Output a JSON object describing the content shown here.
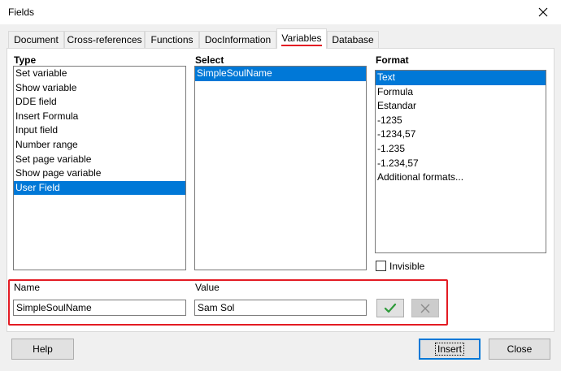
{
  "window": {
    "title": "Fields"
  },
  "tabs": [
    {
      "label": "Document"
    },
    {
      "label": "Cross-references"
    },
    {
      "label": "Functions"
    },
    {
      "label": "DocInformation"
    },
    {
      "label": "Variables"
    },
    {
      "label": "Database"
    }
  ],
  "type": {
    "label": "Type",
    "items": [
      "Set variable",
      "Show variable",
      "DDE field",
      "Insert Formula",
      "Input field",
      "Number range",
      "Set page variable",
      "Show page variable",
      "User Field"
    ],
    "selected": "User Field"
  },
  "select": {
    "label": "Select",
    "items": [
      "SimpleSoulName"
    ],
    "selected": "SimpleSoulName"
  },
  "format": {
    "label": "Format",
    "items": [
      "Text",
      "Formula",
      "Estandar",
      "-1235",
      "-1234,57",
      "-1.235",
      "-1.234,57",
      "Additional formats..."
    ],
    "selected": "Text"
  },
  "invisible": {
    "label": "Invisible",
    "checked": false
  },
  "name": {
    "label": "Name",
    "value": "SimpleSoulName"
  },
  "value": {
    "label": "Value",
    "value": "Sam Sol"
  },
  "buttons": {
    "apply_icon": "checkmark-icon",
    "delete_icon": "x-icon",
    "help": "Help",
    "insert": "Insert",
    "close": "Close"
  },
  "colors": {
    "selection": "#0078d7",
    "highlight": "#e31b23",
    "check": "#2e9b3a"
  }
}
